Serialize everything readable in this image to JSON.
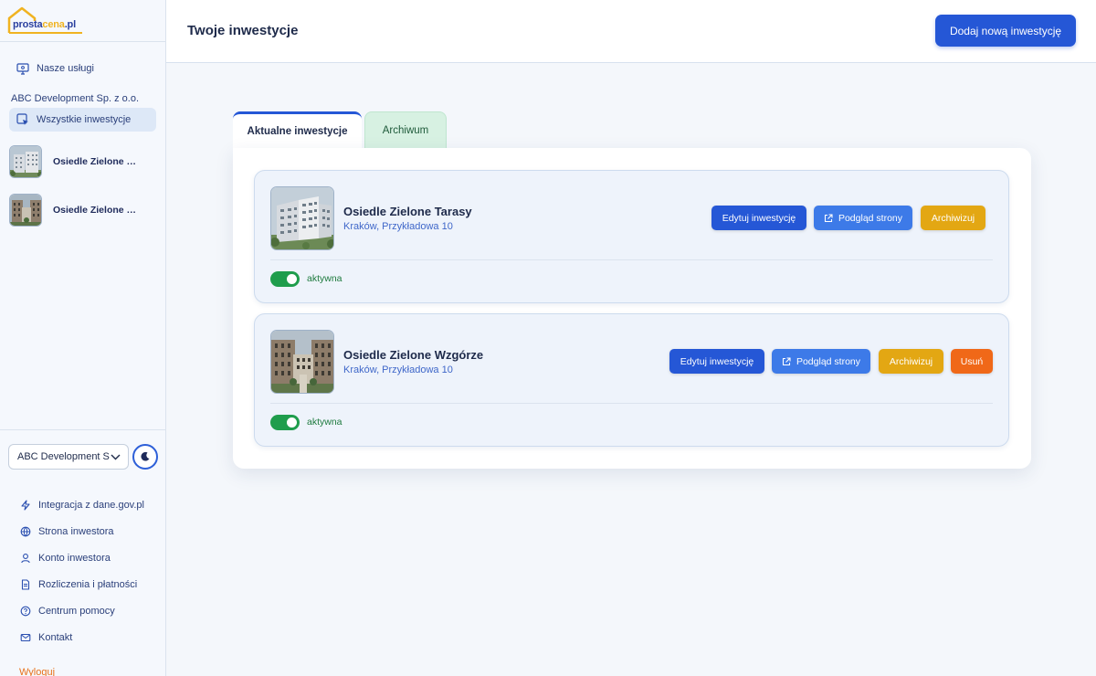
{
  "brand": {
    "logo_text_main": "prosta",
    "logo_text_highlight": "cena",
    "logo_text_suffix": ".pl"
  },
  "sidebar": {
    "services_label": "Nasze usługi",
    "company_name": "ABC Development Sp. z o.o.",
    "all_investments_label": "Wszystkie inwestycje",
    "investments": [
      {
        "label": "Osiedle Zielone Tarasy"
      },
      {
        "label": "Osiedle Zielone Wzgórze"
      }
    ],
    "org_select_value": "ABC Development S",
    "bottom_nav": [
      {
        "label": "Integracja z dane.gov.pl",
        "icon": "bolt-icon"
      },
      {
        "label": "Strona inwestora",
        "icon": "globe-icon"
      },
      {
        "label": "Konto inwestora",
        "icon": "user-icon"
      },
      {
        "label": "Rozliczenia i płatności",
        "icon": "document-icon"
      },
      {
        "label": "Centrum pomocy",
        "icon": "help-icon"
      },
      {
        "label": "Kontakt",
        "icon": "mail-icon"
      }
    ],
    "logout_label": "Wyloguj"
  },
  "header": {
    "title": "Twoje inwestycje",
    "add_button_label": "Dodaj nową inwestycję"
  },
  "tabs": {
    "current_label": "Aktualne inwestycje",
    "archive_label": "Archiwum"
  },
  "cards": [
    {
      "name": "Osiedle Zielone Tarasy",
      "address": "Kraków, Przykładowa 10",
      "status": "aktywna",
      "edit_label": "Edytuj inwestycję",
      "preview_label": "Podgląd strony",
      "archive_label": "Archiwizuj"
    },
    {
      "name": "Osiedle Zielone Wzgórze",
      "address": "Kraków, Przykładowa 10",
      "status": "aktywna",
      "edit_label": "Edytuj inwestycję",
      "preview_label": "Podgląd strony",
      "archive_label": "Archiwizuj",
      "delete_label": "Usuń"
    }
  ],
  "colors": {
    "primary": "#2557d6",
    "archive": "#e3a713",
    "delete": "#f06818",
    "active_toggle": "#1f9d4c",
    "logout": "#e8711a"
  }
}
